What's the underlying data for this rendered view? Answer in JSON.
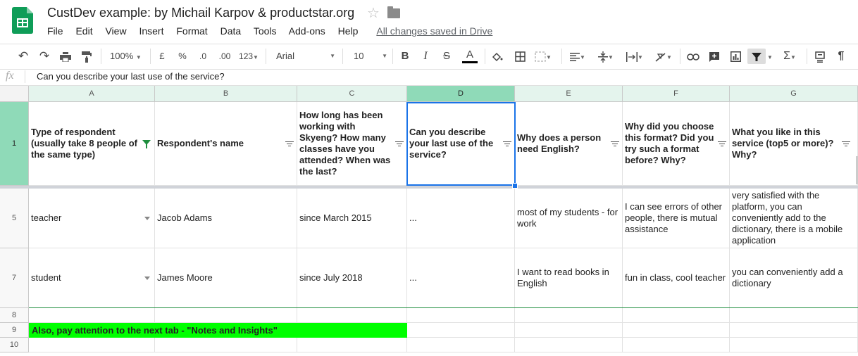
{
  "doc": {
    "title": "CustDev example: by Michail Karpov & productstar.org",
    "saved_status": "All changes saved in Drive"
  },
  "menu": [
    "File",
    "Edit",
    "View",
    "Insert",
    "Format",
    "Data",
    "Tools",
    "Add-ons",
    "Help"
  ],
  "toolbar": {
    "zoom": "100%",
    "currency": "£",
    "percent": "%",
    "dec_decrease": ".0",
    "dec_increase": ".00",
    "more_formats": "123",
    "font": "Arial",
    "font_size": "10",
    "bold": "B",
    "italic": "I",
    "strike": "S",
    "text_color": "A",
    "sigma": "Σ",
    "pilcrow": "¶"
  },
  "formula": {
    "fx": "fx",
    "content": "Can you describe your last use of the service?"
  },
  "columns": [
    "A",
    "B",
    "C",
    "D",
    "E",
    "F",
    "G"
  ],
  "header_row": {
    "num": "1",
    "cells": [
      "Type of respondent (usually take 8 people of the same type)",
      "Respondent's name",
      "How long has been working with Skyeng? How many classes have you attended? When was the last?",
      "Can you describe your last use of the service?",
      "Why does a person need English?",
      "Why did you choose this format? Did you try such a format before? Why?",
      "What you like in this service (top5 or more)? Why?"
    ]
  },
  "rows": [
    {
      "num": "5",
      "cells": [
        "teacher",
        "Jacob Adams",
        "since March 2015",
        "...",
        "most of my students - for work",
        "I can see errors of other people, there is mutual assistance",
        "very satisfied with the platform, you can conveniently add to the dictionary, there is a mobile application"
      ]
    },
    {
      "num": "7",
      "cells": [
        "student",
        "James Moore",
        "since July 2018",
        "...",
        "I want to read books in English",
        "fun in class, cool teacher",
        "you can conveniently add a dictionary"
      ]
    }
  ],
  "extra_rows": [
    "8",
    "9",
    "10"
  ],
  "note": "Also, pay attention to the next tab - \"Notes and Insights\"",
  "colors": {
    "header_bg": "#e4f4ed",
    "selected_header": "#8fdab8",
    "selection": "#1a73e8",
    "filter_green": "#1e8e3e",
    "highlight": "#00ff00"
  }
}
